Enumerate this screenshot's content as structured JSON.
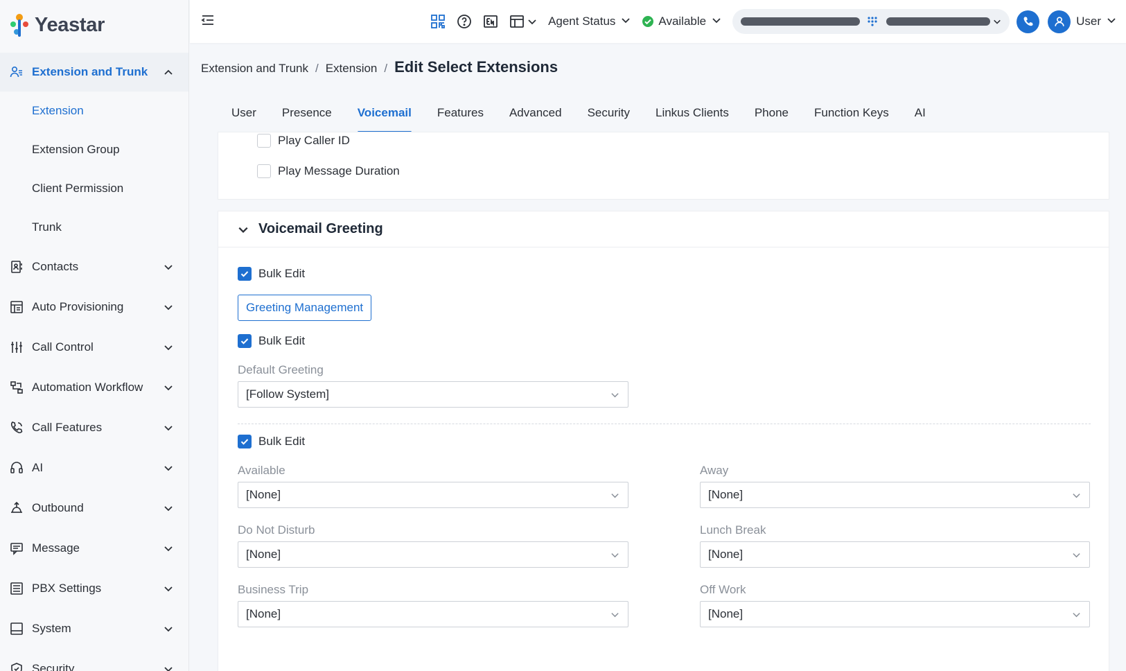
{
  "brand": {
    "name": "Yeastar"
  },
  "sidebar": {
    "active_group": {
      "label": "Extension and Trunk",
      "icon": "user-settings-icon"
    },
    "sub_items": [
      {
        "label": "Extension",
        "active": true
      },
      {
        "label": "Extension Group"
      },
      {
        "label": "Client Permission"
      },
      {
        "label": "Trunk"
      }
    ],
    "groups": [
      {
        "label": "Contacts",
        "icon": "contacts-icon"
      },
      {
        "label": "Auto Provisioning",
        "icon": "provisioning-icon"
      },
      {
        "label": "Call Control",
        "icon": "sliders-icon"
      },
      {
        "label": "Automation Workflow",
        "icon": "workflow-icon"
      },
      {
        "label": "Call Features",
        "icon": "phone-icon"
      },
      {
        "label": "AI",
        "icon": "headset-icon"
      },
      {
        "label": "Outbound",
        "icon": "outbound-icon"
      },
      {
        "label": "Message",
        "icon": "message-icon"
      },
      {
        "label": "PBX Settings",
        "icon": "settings-list-icon"
      },
      {
        "label": "System",
        "icon": "system-icon"
      },
      {
        "label": "Security",
        "icon": "shield-icon"
      }
    ]
  },
  "topbar": {
    "agent_status": "Agent Status",
    "presence": "Available",
    "user": "User",
    "accent": "#1e6fd0",
    "presence_color": "#2eb352"
  },
  "breadcrumb": {
    "items": [
      "Extension and Trunk",
      "Extension"
    ],
    "current": "Edit Select Extensions"
  },
  "tabs": [
    "User",
    "Presence",
    "Voicemail",
    "Features",
    "Advanced",
    "Security",
    "Linkus Clients",
    "Phone",
    "Function Keys",
    "AI"
  ],
  "voicemail_options": {
    "play_caller_id": "Play Caller ID",
    "play_message_duration": "Play Message Duration"
  },
  "greeting": {
    "section_title": "Voicemail Greeting",
    "bulk_edit": "Bulk Edit",
    "greeting_management_button": "Greeting Management",
    "default_greeting_label": "Default Greeting",
    "default_greeting_value": "[Follow System]",
    "fields": {
      "available": {
        "label": "Available",
        "value": "[None]"
      },
      "away": {
        "label": "Away",
        "value": "[None]"
      },
      "do_not_disturb": {
        "label": "Do Not Disturb",
        "value": "[None]"
      },
      "lunch_break": {
        "label": "Lunch Break",
        "value": "[None]"
      },
      "business_trip": {
        "label": "Business Trip",
        "value": "[None]"
      },
      "off_work": {
        "label": "Off Work",
        "value": "[None]"
      }
    }
  }
}
